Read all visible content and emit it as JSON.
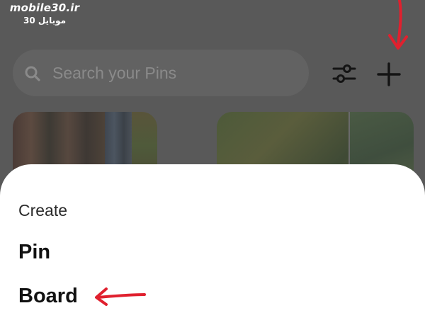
{
  "watermark": {
    "title": "mobile30.ir",
    "subtitle": "موبایل 30"
  },
  "search": {
    "placeholder": "Search your Pins"
  },
  "toolbar": {
    "filter_icon": "filter-sliders-icon",
    "add_icon": "plus-icon"
  },
  "boards": [
    {
      "icon": "pin-thumbnail-forest"
    },
    {
      "icon": "pin-thumbnail-forest"
    }
  ],
  "sheet": {
    "title": "Create",
    "items": [
      {
        "label": "Pin"
      },
      {
        "label": "Board"
      }
    ]
  },
  "colors": {
    "overlay": "#595959",
    "sheet": "#ffffff",
    "annotation": "#e0202e",
    "text_primary": "#111111"
  }
}
